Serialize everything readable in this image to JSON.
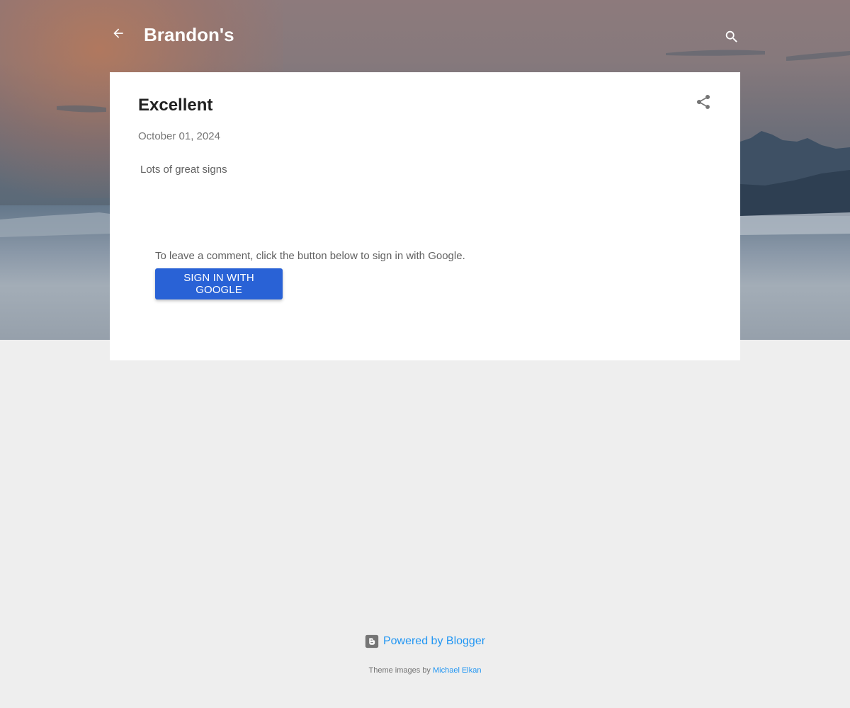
{
  "header": {
    "blog_title": "Brandon's",
    "back_icon": "arrow-left-icon",
    "search_icon": "search-icon"
  },
  "post": {
    "title": "Excellent",
    "date": "October 01, 2024",
    "body": "Lots of great signs",
    "share_icon": "share-icon"
  },
  "comments": {
    "prompt": "To leave a comment, click the button below to sign in with Google.",
    "signin_label": "SIGN IN WITH GOOGLE"
  },
  "footer": {
    "powered_by": "Powered by Blogger",
    "credit_prefix": "Theme images by",
    "credit_name": "Michael Elkan",
    "blogger_icon": "blogger-icon"
  },
  "colors": {
    "accent": "#2962d6",
    "link": "#2196f3",
    "page_bg": "#eeeeee",
    "card_bg": "#ffffff"
  }
}
